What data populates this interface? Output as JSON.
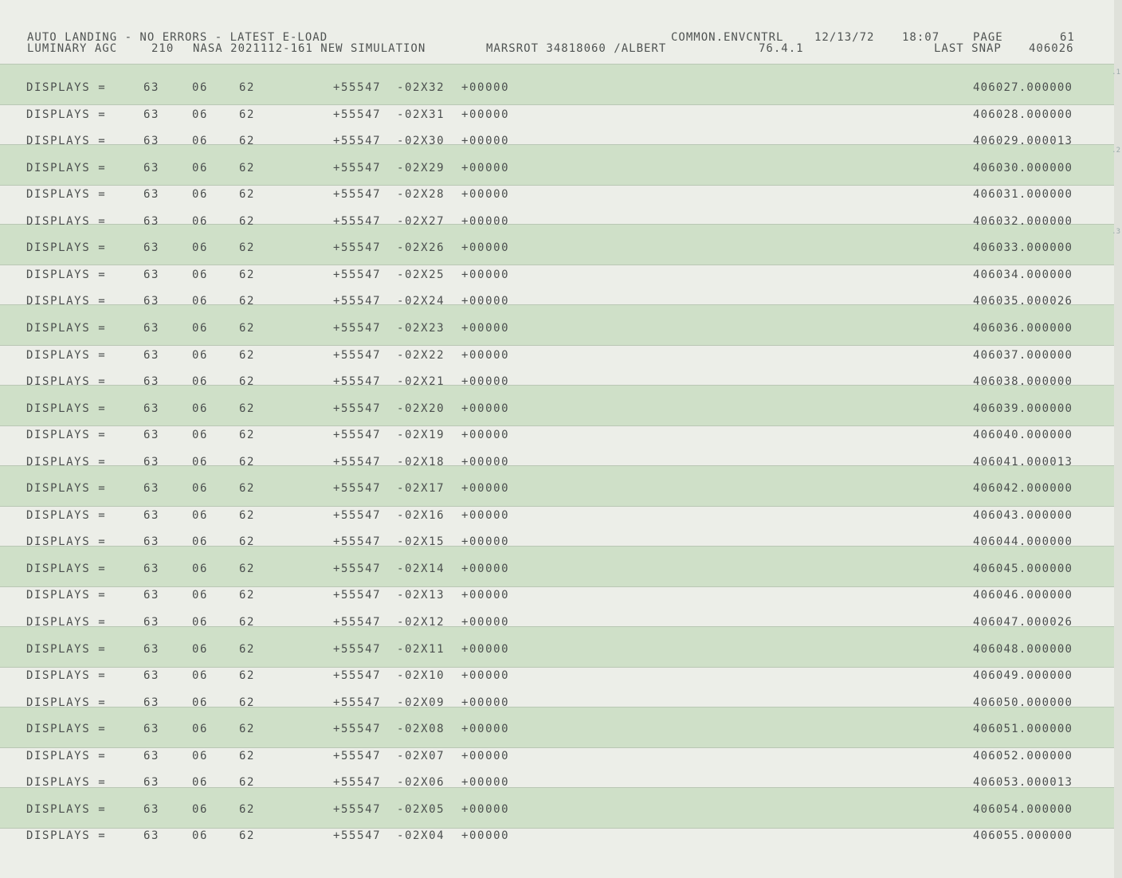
{
  "header": {
    "line1_left": "AUTO LANDING - NO ERRORS - LATEST E-LOAD",
    "line2_left": "LUMINARY AGC",
    "line2_code": "210",
    "line2_program": "NASA 2021112-161 NEW SIMULATION",
    "line2_marsrot": "MARSROT 34818060 /ALBERT",
    "line1_common": "COMMON.ENVCNTRL",
    "line2_version": "76.4.1",
    "line1_date": "12/13/72",
    "line1_time": "18:07",
    "line1_page_label": "PAGE",
    "line1_page_num": "61",
    "line2_snap_label": "LAST SNAP",
    "line2_snap_num": "406026"
  },
  "rows": [
    {
      "label": "DISPLAYS =",
      "a": "63",
      "b": "06",
      "c": "62",
      "d": "+55547",
      "e": "-02X32",
      "f": "+00000",
      "g": "406027.000000"
    },
    {
      "label": "DISPLAYS =",
      "a": "63",
      "b": "06",
      "c": "62",
      "d": "+55547",
      "e": "-02X31",
      "f": "+00000",
      "g": "406028.000000"
    },
    {
      "label": "DISPLAYS =",
      "a": "63",
      "b": "06",
      "c": "62",
      "d": "+55547",
      "e": "-02X30",
      "f": "+00000",
      "g": "406029.000013"
    },
    {
      "label": "DISPLAYS =",
      "a": "63",
      "b": "06",
      "c": "62",
      "d": "+55547",
      "e": "-02X29",
      "f": "+00000",
      "g": "406030.000000"
    },
    {
      "label": "DISPLAYS =",
      "a": "63",
      "b": "06",
      "c": "62",
      "d": "+55547",
      "e": "-02X28",
      "f": "+00000",
      "g": "406031.000000"
    },
    {
      "label": "DISPLAYS =",
      "a": "63",
      "b": "06",
      "c": "62",
      "d": "+55547",
      "e": "-02X27",
      "f": "+00000",
      "g": "406032.000000"
    },
    {
      "label": "DISPLAYS =",
      "a": "63",
      "b": "06",
      "c": "62",
      "d": "+55547",
      "e": "-02X26",
      "f": "+00000",
      "g": "406033.000000"
    },
    {
      "label": "DISPLAYS =",
      "a": "63",
      "b": "06",
      "c": "62",
      "d": "+55547",
      "e": "-02X25",
      "f": "+00000",
      "g": "406034.000000"
    },
    {
      "label": "DISPLAYS =",
      "a": "63",
      "b": "06",
      "c": "62",
      "d": "+55547",
      "e": "-02X24",
      "f": "+00000",
      "g": "406035.000026"
    },
    {
      "label": "DISPLAYS =",
      "a": "63",
      "b": "06",
      "c": "62",
      "d": "+55547",
      "e": "-02X23",
      "f": "+00000",
      "g": "406036.000000"
    },
    {
      "label": "DISPLAYS =",
      "a": "63",
      "b": "06",
      "c": "62",
      "d": "+55547",
      "e": "-02X22",
      "f": "+00000",
      "g": "406037.000000"
    },
    {
      "label": "DISPLAYS =",
      "a": "63",
      "b": "06",
      "c": "62",
      "d": "+55547",
      "e": "-02X21",
      "f": "+00000",
      "g": "406038.000000"
    },
    {
      "label": "DISPLAYS =",
      "a": "63",
      "b": "06",
      "c": "62",
      "d": "+55547",
      "e": "-02X20",
      "f": "+00000",
      "g": "406039.000000"
    },
    {
      "label": "DISPLAYS =",
      "a": "63",
      "b": "06",
      "c": "62",
      "d": "+55547",
      "e": "-02X19",
      "f": "+00000",
      "g": "406040.000000"
    },
    {
      "label": "DISPLAYS =",
      "a": "63",
      "b": "06",
      "c": "62",
      "d": "+55547",
      "e": "-02X18",
      "f": "+00000",
      "g": "406041.000013"
    },
    {
      "label": "DISPLAYS =",
      "a": "63",
      "b": "06",
      "c": "62",
      "d": "+55547",
      "e": "-02X17",
      "f": "+00000",
      "g": "406042.000000"
    },
    {
      "label": "DISPLAYS =",
      "a": "63",
      "b": "06",
      "c": "62",
      "d": "+55547",
      "e": "-02X16",
      "f": "+00000",
      "g": "406043.000000"
    },
    {
      "label": "DISPLAYS =",
      "a": "63",
      "b": "06",
      "c": "62",
      "d": "+55547",
      "e": "-02X15",
      "f": "+00000",
      "g": "406044.000000"
    },
    {
      "label": "DISPLAYS =",
      "a": "63",
      "b": "06",
      "c": "62",
      "d": "+55547",
      "e": "-02X14",
      "f": "+00000",
      "g": "406045.000000"
    },
    {
      "label": "DISPLAYS =",
      "a": "63",
      "b": "06",
      "c": "62",
      "d": "+55547",
      "e": "-02X13",
      "f": "+00000",
      "g": "406046.000000"
    },
    {
      "label": "DISPLAYS =",
      "a": "63",
      "b": "06",
      "c": "62",
      "d": "+55547",
      "e": "-02X12",
      "f": "+00000",
      "g": "406047.000026"
    },
    {
      "label": "DISPLAYS =",
      "a": "63",
      "b": "06",
      "c": "62",
      "d": "+55547",
      "e": "-02X11",
      "f": "+00000",
      "g": "406048.000000"
    },
    {
      "label": "DISPLAYS =",
      "a": "63",
      "b": "06",
      "c": "62",
      "d": "+55547",
      "e": "-02X10",
      "f": "+00000",
      "g": "406049.000000"
    },
    {
      "label": "DISPLAYS =",
      "a": "63",
      "b": "06",
      "c": "62",
      "d": "+55547",
      "e": "-02X09",
      "f": "+00000",
      "g": "406050.000000"
    },
    {
      "label": "DISPLAYS =",
      "a": "63",
      "b": "06",
      "c": "62",
      "d": "+55547",
      "e": "-02X08",
      "f": "+00000",
      "g": "406051.000000"
    },
    {
      "label": "DISPLAYS =",
      "a": "63",
      "b": "06",
      "c": "62",
      "d": "+55547",
      "e": "-02X07",
      "f": "+00000",
      "g": "406052.000000"
    },
    {
      "label": "DISPLAYS =",
      "a": "63",
      "b": "06",
      "c": "62",
      "d": "+55547",
      "e": "-02X06",
      "f": "+00000",
      "g": "406053.000013"
    },
    {
      "label": "DISPLAYS =",
      "a": "63",
      "b": "06",
      "c": "62",
      "d": "+55547",
      "e": "-02X05",
      "f": "+00000",
      "g": "406054.000000"
    },
    {
      "label": "DISPLAYS =",
      "a": "63",
      "b": "06",
      "c": "62",
      "d": "+55547",
      "e": "-02X04",
      "f": "+00000",
      "g": "406055.000000"
    }
  ],
  "colors": {
    "band": "#cfe0c8",
    "paper": "#eceee8",
    "ink": "#4b4f4e"
  }
}
